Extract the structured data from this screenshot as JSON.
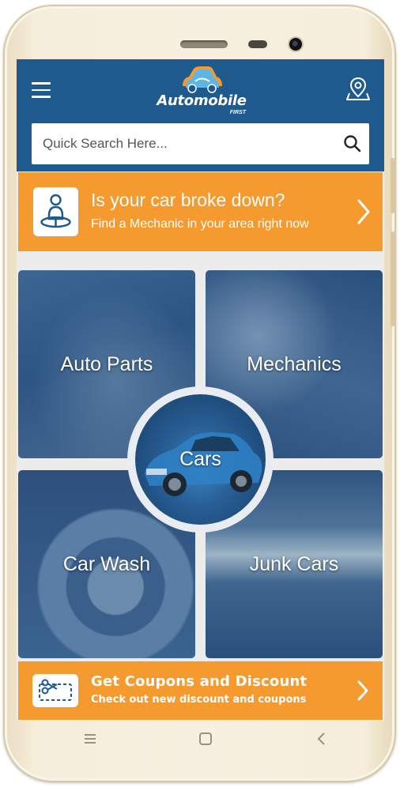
{
  "app": {
    "name": "Automobile",
    "subname": "FIRST"
  },
  "search": {
    "placeholder": "Quick Search Here..."
  },
  "banner_top": {
    "title": "Is your car broke down?",
    "subtitle": "Find a Mechanic in your area right now"
  },
  "categories": {
    "auto_parts": "Auto Parts",
    "mechanics": "Mechanics",
    "cars": "Cars",
    "car_wash": "Car Wash",
    "junk_cars": "Junk Cars"
  },
  "banner_bottom": {
    "title": "Get Coupons and Discount",
    "subtitle": "Check out new discount and coupons"
  },
  "colors": {
    "primary": "#1e5a8e",
    "accent": "#f59a2f",
    "background": "#ececec"
  },
  "icons": {
    "menu": "hamburger-icon",
    "location": "location-pin-icon",
    "search": "search-icon",
    "mechanic": "mechanic-icon",
    "coupon": "scissors-coupon-icon",
    "chevron": "chevron-right-icon"
  }
}
